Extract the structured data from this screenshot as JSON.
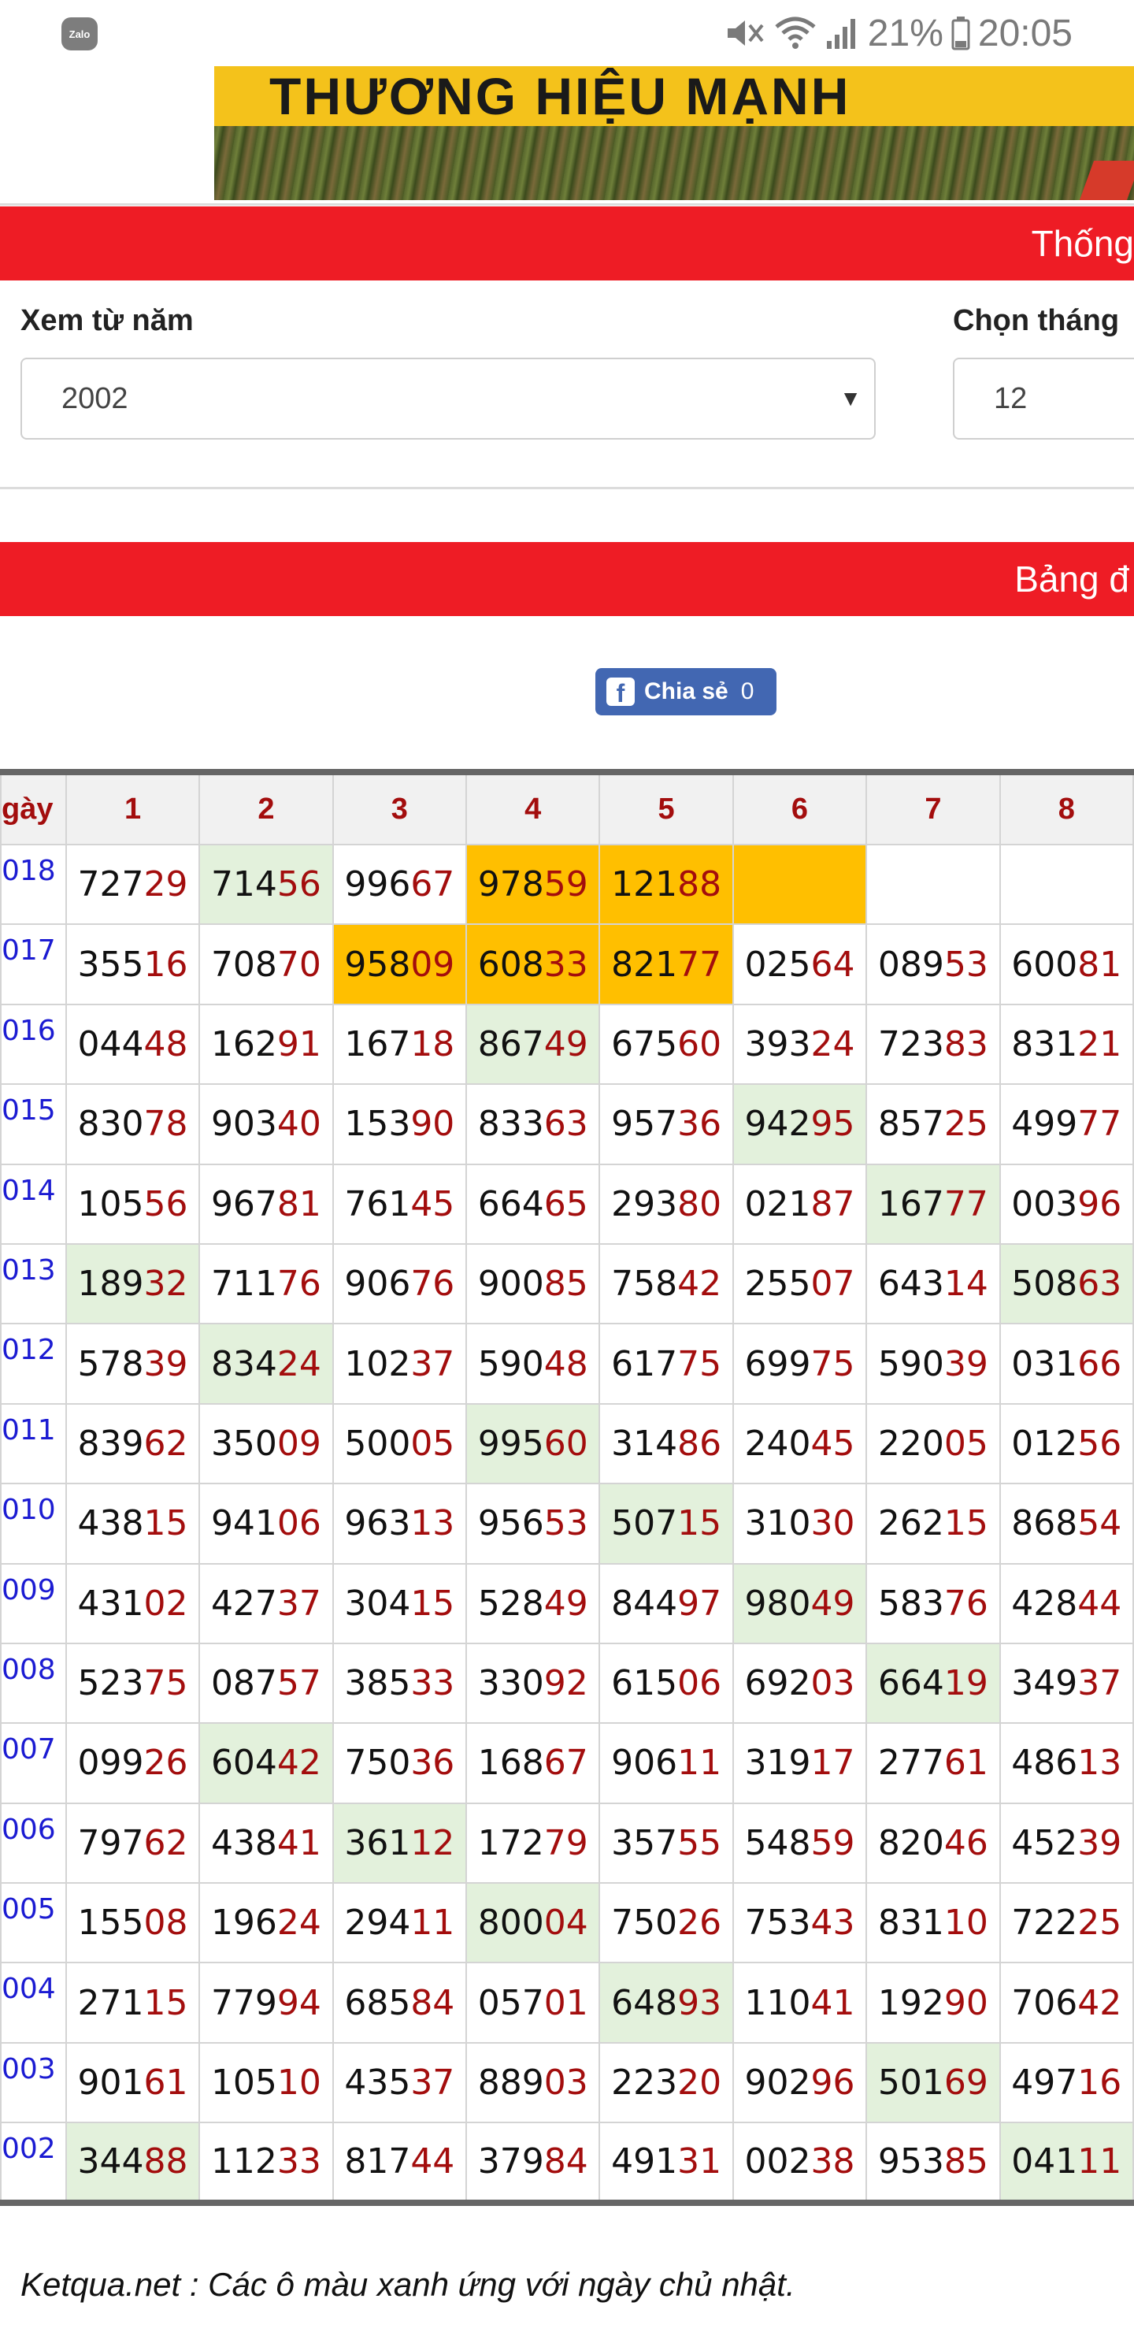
{
  "status": {
    "time": "20:05",
    "battery": "21%",
    "app_badge": "Zalo"
  },
  "ad": {
    "text": "THƯƠNG HIỆU MẠNH"
  },
  "headers": {
    "stats_title": "Thống",
    "table_title": "Bảng đ"
  },
  "filter": {
    "year_label": "Xem từ năm",
    "year_value": "2002",
    "month_label": "Chọn tháng",
    "month_value": "12"
  },
  "share": {
    "label": "Chia sẻ",
    "count": "0"
  },
  "table": {
    "corner": "gày",
    "columns": [
      "1",
      "2",
      "3",
      "4",
      "5",
      "6",
      "7",
      "8"
    ],
    "rows": [
      {
        "year": "018",
        "cells": [
          {
            "head": "727",
            "tail": "29",
            "bg": ""
          },
          {
            "head": "714",
            "tail": "56",
            "bg": "sun"
          },
          {
            "head": "996",
            "tail": "67",
            "bg": ""
          },
          {
            "head": "978",
            "tail": "59",
            "bg": "hi"
          },
          {
            "head": "121",
            "tail": "88",
            "bg": "hi"
          },
          {
            "head": "",
            "tail": "",
            "bg": "hi"
          },
          {
            "head": "",
            "tail": "",
            "bg": ""
          },
          {
            "head": "",
            "tail": "",
            "bg": ""
          }
        ]
      },
      {
        "year": "017",
        "cells": [
          {
            "head": "355",
            "tail": "16",
            "bg": ""
          },
          {
            "head": "708",
            "tail": "70",
            "bg": ""
          },
          {
            "head": "958",
            "tail": "09",
            "bg": "hi"
          },
          {
            "head": "608",
            "tail": "33",
            "bg": "hi"
          },
          {
            "head": "821",
            "tail": "77",
            "bg": "hi"
          },
          {
            "head": "025",
            "tail": "64",
            "bg": ""
          },
          {
            "head": "089",
            "tail": "53",
            "bg": ""
          },
          {
            "head": "600",
            "tail": "81",
            "bg": ""
          }
        ]
      },
      {
        "year": "016",
        "cells": [
          {
            "head": "044",
            "tail": "48",
            "bg": ""
          },
          {
            "head": "162",
            "tail": "91",
            "bg": ""
          },
          {
            "head": "167",
            "tail": "18",
            "bg": ""
          },
          {
            "head": "867",
            "tail": "49",
            "bg": "sun"
          },
          {
            "head": "675",
            "tail": "60",
            "bg": ""
          },
          {
            "head": "393",
            "tail": "24",
            "bg": ""
          },
          {
            "head": "723",
            "tail": "83",
            "bg": ""
          },
          {
            "head": "831",
            "tail": "21",
            "bg": ""
          }
        ]
      },
      {
        "year": "015",
        "cells": [
          {
            "head": "830",
            "tail": "78",
            "bg": ""
          },
          {
            "head": "903",
            "tail": "40",
            "bg": ""
          },
          {
            "head": "153",
            "tail": "90",
            "bg": ""
          },
          {
            "head": "833",
            "tail": "63",
            "bg": ""
          },
          {
            "head": "957",
            "tail": "36",
            "bg": ""
          },
          {
            "head": "942",
            "tail": "95",
            "bg": "sun"
          },
          {
            "head": "857",
            "tail": "25",
            "bg": ""
          },
          {
            "head": "499",
            "tail": "77",
            "bg": ""
          }
        ]
      },
      {
        "year": "014",
        "cells": [
          {
            "head": "105",
            "tail": "56",
            "bg": ""
          },
          {
            "head": "967",
            "tail": "81",
            "bg": ""
          },
          {
            "head": "761",
            "tail": "45",
            "bg": ""
          },
          {
            "head": "664",
            "tail": "65",
            "bg": ""
          },
          {
            "head": "293",
            "tail": "80",
            "bg": ""
          },
          {
            "head": "021",
            "tail": "87",
            "bg": ""
          },
          {
            "head": "167",
            "tail": "77",
            "bg": "sun"
          },
          {
            "head": "003",
            "tail": "96",
            "bg": ""
          }
        ]
      },
      {
        "year": "013",
        "cells": [
          {
            "head": "189",
            "tail": "32",
            "bg": "sun"
          },
          {
            "head": "711",
            "tail": "76",
            "bg": ""
          },
          {
            "head": "906",
            "tail": "76",
            "bg": ""
          },
          {
            "head": "900",
            "tail": "85",
            "bg": ""
          },
          {
            "head": "758",
            "tail": "42",
            "bg": ""
          },
          {
            "head": "255",
            "tail": "07",
            "bg": ""
          },
          {
            "head": "643",
            "tail": "14",
            "bg": ""
          },
          {
            "head": "508",
            "tail": "63",
            "bg": "sun"
          }
        ]
      },
      {
        "year": "012",
        "cells": [
          {
            "head": "578",
            "tail": "39",
            "bg": ""
          },
          {
            "head": "834",
            "tail": "24",
            "bg": "sun"
          },
          {
            "head": "102",
            "tail": "37",
            "bg": ""
          },
          {
            "head": "590",
            "tail": "48",
            "bg": ""
          },
          {
            "head": "617",
            "tail": "75",
            "bg": ""
          },
          {
            "head": "699",
            "tail": "75",
            "bg": ""
          },
          {
            "head": "590",
            "tail": "39",
            "bg": ""
          },
          {
            "head": "031",
            "tail": "66",
            "bg": ""
          }
        ]
      },
      {
        "year": "011",
        "cells": [
          {
            "head": "839",
            "tail": "62",
            "bg": ""
          },
          {
            "head": "350",
            "tail": "09",
            "bg": ""
          },
          {
            "head": "500",
            "tail": "05",
            "bg": ""
          },
          {
            "head": "995",
            "tail": "60",
            "bg": "sun"
          },
          {
            "head": "314",
            "tail": "86",
            "bg": ""
          },
          {
            "head": "240",
            "tail": "45",
            "bg": ""
          },
          {
            "head": "220",
            "tail": "05",
            "bg": ""
          },
          {
            "head": "012",
            "tail": "56",
            "bg": ""
          }
        ]
      },
      {
        "year": "010",
        "cells": [
          {
            "head": "438",
            "tail": "15",
            "bg": ""
          },
          {
            "head": "941",
            "tail": "06",
            "bg": ""
          },
          {
            "head": "963",
            "tail": "13",
            "bg": ""
          },
          {
            "head": "956",
            "tail": "53",
            "bg": ""
          },
          {
            "head": "507",
            "tail": "15",
            "bg": "sun"
          },
          {
            "head": "310",
            "tail": "30",
            "bg": ""
          },
          {
            "head": "262",
            "tail": "15",
            "bg": ""
          },
          {
            "head": "868",
            "tail": "54",
            "bg": ""
          }
        ]
      },
      {
        "year": "009",
        "cells": [
          {
            "head": "431",
            "tail": "02",
            "bg": ""
          },
          {
            "head": "427",
            "tail": "37",
            "bg": ""
          },
          {
            "head": "304",
            "tail": "15",
            "bg": ""
          },
          {
            "head": "528",
            "tail": "49",
            "bg": ""
          },
          {
            "head": "844",
            "tail": "97",
            "bg": ""
          },
          {
            "head": "980",
            "tail": "49",
            "bg": "sun"
          },
          {
            "head": "583",
            "tail": "76",
            "bg": ""
          },
          {
            "head": "428",
            "tail": "44",
            "bg": ""
          }
        ]
      },
      {
        "year": "008",
        "cells": [
          {
            "head": "523",
            "tail": "75",
            "bg": ""
          },
          {
            "head": "087",
            "tail": "57",
            "bg": ""
          },
          {
            "head": "385",
            "tail": "33",
            "bg": ""
          },
          {
            "head": "330",
            "tail": "92",
            "bg": ""
          },
          {
            "head": "615",
            "tail": "06",
            "bg": ""
          },
          {
            "head": "692",
            "tail": "03",
            "bg": ""
          },
          {
            "head": "664",
            "tail": "19",
            "bg": "sun"
          },
          {
            "head": "349",
            "tail": "37",
            "bg": ""
          }
        ]
      },
      {
        "year": "007",
        "cells": [
          {
            "head": "099",
            "tail": "26",
            "bg": ""
          },
          {
            "head": "604",
            "tail": "42",
            "bg": "sun"
          },
          {
            "head": "750",
            "tail": "36",
            "bg": ""
          },
          {
            "head": "168",
            "tail": "67",
            "bg": ""
          },
          {
            "head": "906",
            "tail": "11",
            "bg": ""
          },
          {
            "head": "319",
            "tail": "17",
            "bg": ""
          },
          {
            "head": "277",
            "tail": "61",
            "bg": ""
          },
          {
            "head": "486",
            "tail": "13",
            "bg": ""
          }
        ]
      },
      {
        "year": "006",
        "cells": [
          {
            "head": "797",
            "tail": "62",
            "bg": ""
          },
          {
            "head": "438",
            "tail": "41",
            "bg": ""
          },
          {
            "head": "361",
            "tail": "12",
            "bg": "sun"
          },
          {
            "head": "172",
            "tail": "79",
            "bg": ""
          },
          {
            "head": "357",
            "tail": "55",
            "bg": ""
          },
          {
            "head": "548",
            "tail": "59",
            "bg": ""
          },
          {
            "head": "820",
            "tail": "46",
            "bg": ""
          },
          {
            "head": "452",
            "tail": "39",
            "bg": ""
          }
        ]
      },
      {
        "year": "005",
        "cells": [
          {
            "head": "155",
            "tail": "08",
            "bg": ""
          },
          {
            "head": "196",
            "tail": "24",
            "bg": ""
          },
          {
            "head": "294",
            "tail": "11",
            "bg": ""
          },
          {
            "head": "800",
            "tail": "04",
            "bg": "sun"
          },
          {
            "head": "750",
            "tail": "26",
            "bg": ""
          },
          {
            "head": "753",
            "tail": "43",
            "bg": ""
          },
          {
            "head": "831",
            "tail": "10",
            "bg": ""
          },
          {
            "head": "722",
            "tail": "25",
            "bg": ""
          }
        ]
      },
      {
        "year": "004",
        "cells": [
          {
            "head": "271",
            "tail": "15",
            "bg": ""
          },
          {
            "head": "779",
            "tail": "94",
            "bg": ""
          },
          {
            "head": "685",
            "tail": "84",
            "bg": ""
          },
          {
            "head": "057",
            "tail": "01",
            "bg": ""
          },
          {
            "head": "648",
            "tail": "93",
            "bg": "sun"
          },
          {
            "head": "110",
            "tail": "41",
            "bg": ""
          },
          {
            "head": "192",
            "tail": "90",
            "bg": ""
          },
          {
            "head": "706",
            "tail": "42",
            "bg": ""
          }
        ]
      },
      {
        "year": "003",
        "cells": [
          {
            "head": "901",
            "tail": "61",
            "bg": ""
          },
          {
            "head": "105",
            "tail": "10",
            "bg": ""
          },
          {
            "head": "435",
            "tail": "37",
            "bg": ""
          },
          {
            "head": "889",
            "tail": "03",
            "bg": ""
          },
          {
            "head": "223",
            "tail": "20",
            "bg": ""
          },
          {
            "head": "902",
            "tail": "96",
            "bg": ""
          },
          {
            "head": "501",
            "tail": "69",
            "bg": "sun"
          },
          {
            "head": "497",
            "tail": "16",
            "bg": ""
          }
        ]
      },
      {
        "year": "002",
        "cells": [
          {
            "head": "344",
            "tail": "88",
            "bg": "sun"
          },
          {
            "head": "112",
            "tail": "33",
            "bg": ""
          },
          {
            "head": "817",
            "tail": "44",
            "bg": ""
          },
          {
            "head": "379",
            "tail": "84",
            "bg": ""
          },
          {
            "head": "491",
            "tail": "31",
            "bg": ""
          },
          {
            "head": "002",
            "tail": "38",
            "bg": ""
          },
          {
            "head": "953",
            "tail": "85",
            "bg": ""
          },
          {
            "head": "041",
            "tail": "11",
            "bg": "sun"
          }
        ]
      }
    ]
  },
  "footer": {
    "note": "Ketqua.net : Các ô màu xanh ứng với ngày chủ nhật."
  },
  "colors": {
    "red_bar": "#ee1c25",
    "sunday_bg": "#e3f1dc",
    "highlight_bg": "#ffbf00",
    "tail_text": "#a30d0d",
    "year_text": "#1b1bd2"
  }
}
